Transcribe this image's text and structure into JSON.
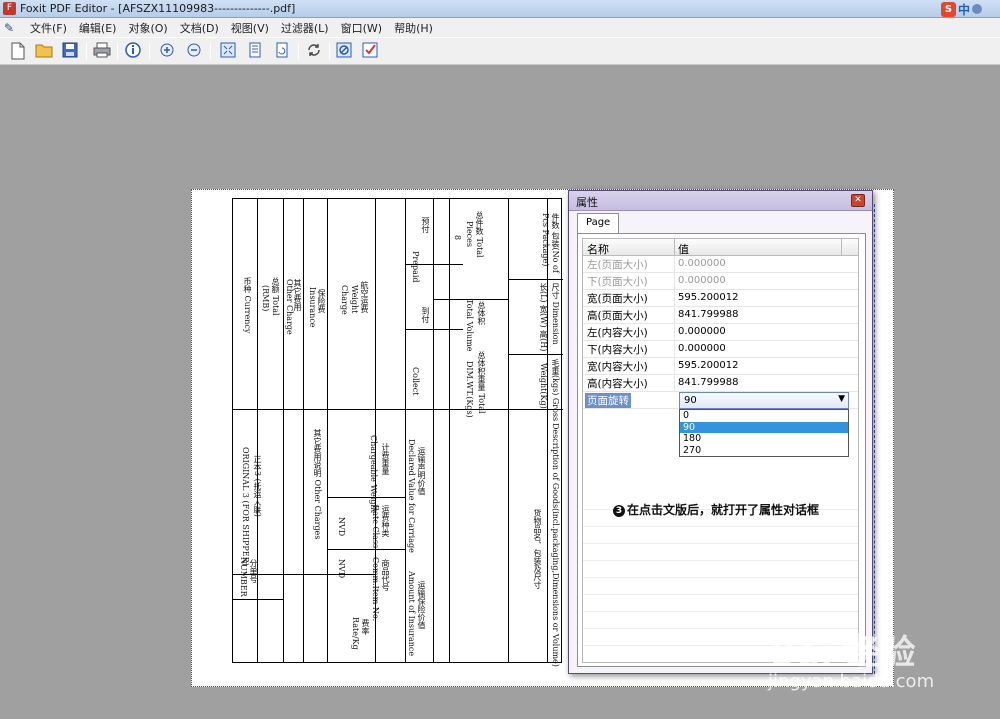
{
  "window": {
    "title": "Foxit PDF Editor - [AFSZX11109983--------------.pdf]",
    "app_icon": "foxit-icon",
    "ime": {
      "logo": "S",
      "lang": "中"
    }
  },
  "menu": {
    "items": [
      "文件(F)",
      "编辑(E)",
      "对象(O)",
      "文档(D)",
      "视图(V)",
      "过滤器(L)",
      "窗口(W)",
      "帮助(H)"
    ]
  },
  "toolbar": {
    "icons": [
      "new-icon",
      "open-folder-icon",
      "save-icon",
      "print-icon",
      "info-icon",
      "zoom-in-icon",
      "zoom-out-icon",
      "fit-page-icon",
      "page-icon",
      "rotate-icon",
      "refresh-icon",
      "stop-icon",
      "check-icon"
    ]
  },
  "document": {
    "labels": {
      "l1": "件数 包装(No of",
      "l2": "Pcs Package)",
      "l3": "总件数 Total",
      "l4": "Pieces",
      "l5": "8",
      "l6": "尺寸 Dimension",
      "l7": "长(L) 宽(W) 高(H)",
      "l8": "总体积",
      "l9": "Total Volume",
      "l10": "毛重(kgs) Gross",
      "l11": "Weight(Kg)",
      "l12": "总体积重量 Total",
      "l13": "DIM.WT.(Kgs)",
      "l14": "预付",
      "l15": "Prepaid",
      "l16": "到付",
      "l17": "Collect",
      "l18": "航空运费",
      "l19": "Weight",
      "l20": "Charge",
      "l21": "保险费",
      "l22": "Insurance",
      "l23": "其它费用",
      "l24": "Other Charge",
      "l25": "总额 Total",
      "l26": "(RMB)",
      "l27": "币种 Currency",
      "l28": "Description of Goods(incl.packaging,Dimensions or Volume)",
      "l29": "货物品名、包装及尺寸",
      "l30": "运输声明价值",
      "l31": "Declared Value for Carriage",
      "l32": "运费种类",
      "l33": "Rate Class",
      "l34": "NVD",
      "l35": "商品代号",
      "l36": "Comm.Item No.",
      "l37": "费率",
      "l38": "Rate/Kg",
      "l39": "运输保险价值",
      "l40": "Amount of Insurance",
      "l41": "计费重量",
      "l42": "Chargeable Weight",
      "l43": "其它费用说明 Other Charges",
      "l44": "正本3 (托运人联)",
      "l45": "ORIGINAL 3 (FOR SHIPPER)",
      "l46": "分单号",
      "l47": "NUMBER"
    }
  },
  "dialog": {
    "title": "属性",
    "tab": "Page",
    "header": {
      "name": "名称",
      "value": "值"
    },
    "properties": [
      {
        "name": "左(页面大小)",
        "value": "0.000000",
        "dim": true
      },
      {
        "name": "下(页面大小)",
        "value": "0.000000",
        "dim": true
      },
      {
        "name": "宽(页面大小)",
        "value": "595.200012",
        "dim": false
      },
      {
        "name": "高(页面大小)",
        "value": "841.799988",
        "dim": false
      },
      {
        "name": "左(内容大小)",
        "value": "0.000000",
        "dim": false
      },
      {
        "name": "下(内容大小)",
        "value": "0.000000",
        "dim": false
      },
      {
        "name": "宽(内容大小)",
        "value": "595.200012",
        "dim": false
      },
      {
        "name": "高(内容大小)",
        "value": "841.799988",
        "dim": false
      }
    ],
    "rotation": {
      "name": "页面旋转",
      "value": "90",
      "options": [
        "0",
        "90",
        "180",
        "270"
      ]
    },
    "note": "在点击文版后，就打开了属性对话框",
    "note_badge": "3"
  },
  "watermark": {
    "logo": "Bai 经验",
    "url": "jingyan.baidu.com"
  }
}
